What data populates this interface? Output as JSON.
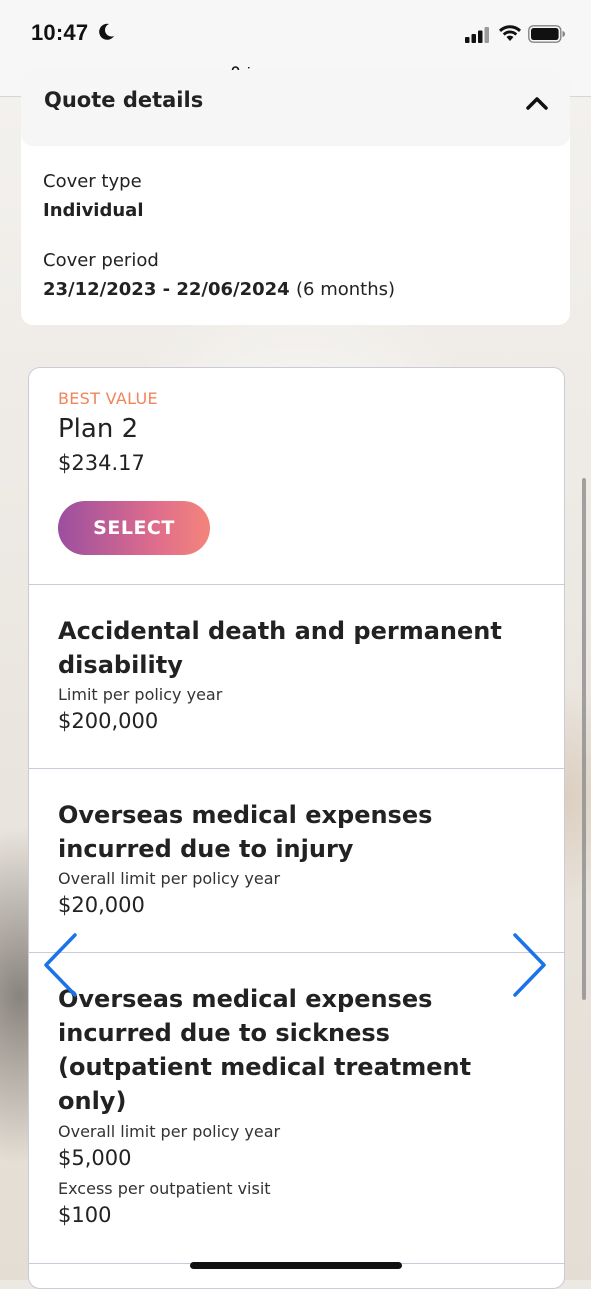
{
  "status_bar": {
    "time": "10:47"
  },
  "browser": {
    "url": "income.com.sg"
  },
  "quote": {
    "title": "Quote details",
    "cover_type_label": "Cover type",
    "cover_type_value": "Individual",
    "cover_period_label": "Cover period",
    "cover_period_dates": "23/12/2023 - 22/06/2024",
    "cover_period_open": "(",
    "cover_period_duration": "6 months",
    "cover_period_close": ")"
  },
  "plan": {
    "badge": "BEST VALUE",
    "name": "Plan 2",
    "price": "$234.17",
    "select_label": "SELECT"
  },
  "benefits": [
    {
      "title": "Accidental death and permanent disability",
      "lines": [
        {
          "label": "Limit per policy year",
          "amount": "$200,000"
        }
      ]
    },
    {
      "title": "Overseas medical expenses incurred due to injury",
      "lines": [
        {
          "label": "Overall limit per policy year",
          "amount": "$20,000"
        }
      ]
    },
    {
      "title": "Overseas medical expenses incurred due to sickness (outpatient medical treatment only)",
      "lines": [
        {
          "label": "Overall limit per policy year",
          "amount": "$5,000"
        },
        {
          "label": "Excess per outpatient visit",
          "amount": "$100"
        }
      ]
    }
  ],
  "icons": {
    "moon": "moon-icon",
    "lock": "lock-icon",
    "caret": "chevron-up-icon",
    "prev": "chevron-left-icon",
    "next": "chevron-right-icon"
  },
  "colors": {
    "accent_orange": "#f0845a",
    "button_gradient_start": "#9b4fa0",
    "button_gradient_end": "#f3857a",
    "arrow_blue": "#1a73e8"
  }
}
